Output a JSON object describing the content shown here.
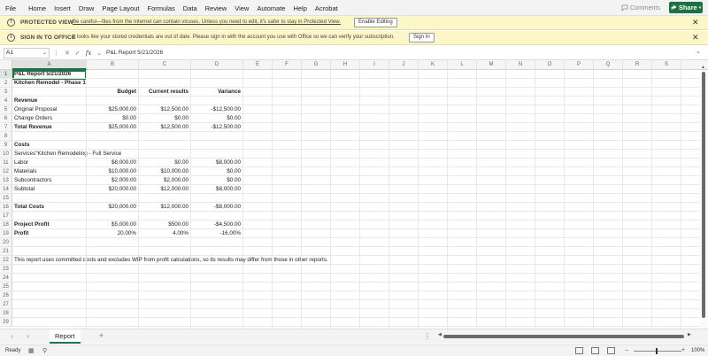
{
  "menubar": {
    "items": [
      "File",
      "Home",
      "Insert",
      "Draw",
      "Page Layout",
      "Formulas",
      "Data",
      "Review",
      "View",
      "Automate",
      "Help",
      "Acrobat"
    ],
    "comments": "Comments",
    "share": "Share"
  },
  "protected_view": {
    "label": "PROTECTED VIEW",
    "message": "Be careful—files from the Internet can contain viruses. Unless you need to edit, it's safer to stay in Protected View.",
    "button": "Enable Editing"
  },
  "signin_bar": {
    "label": "SIGN IN TO OFFICE",
    "message": "It looks like your stored credentials are out of date. Please sign in with the account you use with Office so we can verify your subscription.",
    "button": "Sign In"
  },
  "formula_bar": {
    "name_box": "A1",
    "value": "P&L Report 5/21/2026"
  },
  "columns": [
    "A",
    "B",
    "C",
    "D",
    "E",
    "F",
    "G",
    "H",
    "I",
    "J",
    "K",
    "L",
    "M",
    "N",
    "O",
    "P",
    "Q",
    "R",
    "S"
  ],
  "rows": [
    "1",
    "2",
    "3",
    "4",
    "5",
    "6",
    "7",
    "8",
    "9",
    "10",
    "11",
    "12",
    "13",
    "14",
    "15",
    "16",
    "17",
    "18",
    "19",
    "20",
    "21",
    "22",
    "23",
    "24",
    "25",
    "26",
    "27",
    "28",
    "29"
  ],
  "cells": {
    "A1": "P&L Report 5/21/2026",
    "A2": "Kitchen Remodel - Phase 1",
    "B3": "Budget",
    "C3": "Current results",
    "D3": "Variance",
    "A4": "Revenue",
    "A5": "Original Proposal",
    "B5": "$25,000.00",
    "C5": "$12,500.00",
    "D5": "-$12,500.00",
    "A6": "Change Orders",
    "B6": "$0.00",
    "C6": "$0.00",
    "D6": "$0.00",
    "A7": "Total Revenue",
    "B7": "$25,000.00",
    "C7": "$12,500.00",
    "D7": "-$12,500.00",
    "A9": "Costs",
    "A10": "Services\"Kitchen Remodeling - Full Service",
    "A11": "Labor",
    "B11": "$8,000.00",
    "C11": "$0.00",
    "D11": "$8,000.00",
    "A12": "Materials",
    "B12": "$10,000.00",
    "C12": "$10,000.00",
    "D12": "$0.00",
    "A13": "Subcontractors",
    "B13": "$2,000.00",
    "C13": "$2,000.00",
    "D13": "$0.00",
    "A14": "Subtotal",
    "B14": "$20,000.00",
    "C14": "$12,000.00",
    "D14": "$8,000.00",
    "A16": "Total Costs",
    "B16": "$20,000.00",
    "C16": "$12,000.00",
    "D16": "-$8,000.00",
    "A18": "Project Profit",
    "B18": "$5,000.00",
    "C18": "$500.00",
    "D18": "-$4,500.00",
    "A19": "Profit",
    "B19": "20.00%",
    "C19": "4.00%",
    "D19": "-16.00%",
    "A22": "This report uses committed costs and excludes WIP from profit calculations, so its results may differ from those in other reports."
  },
  "sheet_tabs": [
    "Report"
  ],
  "status": "Ready",
  "zoom": "100%"
}
